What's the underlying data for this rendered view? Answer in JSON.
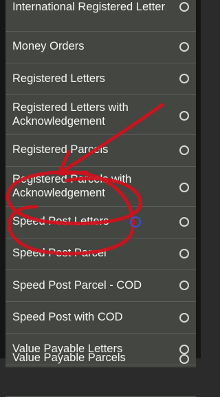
{
  "options": [
    {
      "lines": [
        "International Registered Letter"
      ]
    },
    {
      "lines": [
        "Money Orders"
      ]
    },
    {
      "lines": [
        "Registered Letters"
      ]
    },
    {
      "lines": [
        "Registered Letters with",
        "Acknowledgement"
      ]
    },
    {
      "lines": [
        "Registered Parcels"
      ]
    },
    {
      "lines": [
        "Registered Parcels with",
        "Acknowledgement"
      ]
    },
    {
      "lines": [
        "Speed Post Letters"
      ]
    },
    {
      "lines": [
        "Speed Post Parcel"
      ]
    },
    {
      "lines": [
        "Speed Post Parcel - COD"
      ]
    },
    {
      "lines": [
        "Speed Post with COD"
      ]
    },
    {
      "lines": [
        "Value Payable Letters"
      ]
    },
    {
      "lines": [
        "Value Payable Parcels"
      ]
    }
  ],
  "colors": {
    "dialog_background": "#434641",
    "text": "#f7f7f4",
    "annotation_ink": "#d3101c",
    "touch_indicator": "#3d4fd6"
  }
}
